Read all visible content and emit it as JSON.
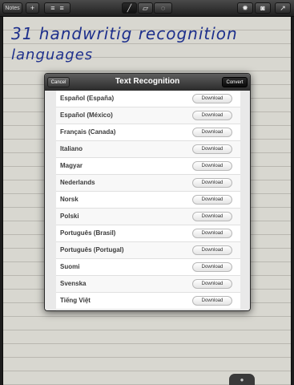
{
  "toolbar": {
    "notes_label": "Notes",
    "add_icon": "+",
    "icons": [
      "align-left-icon",
      "align-right-icon",
      "pen-icon",
      "eraser-icon",
      "lasso-icon",
      "gear-icon",
      "camera-icon",
      "share-icon"
    ]
  },
  "note": {
    "line1": "31 handwritig recognition",
    "line2": "languages"
  },
  "modal": {
    "title": "Text Recognition",
    "cancel_label": "Cancel",
    "convert_label": "Convert",
    "download_label": "Download",
    "languages": [
      "Español (España)",
      "Español (México)",
      "Français (Canada)",
      "Italiano",
      "Magyar",
      "Nederlands",
      "Norsk",
      "Polski",
      "Português (Brasil)",
      "Português (Portugal)",
      "Suomi",
      "Svenska",
      "Tiếng Việt"
    ]
  }
}
